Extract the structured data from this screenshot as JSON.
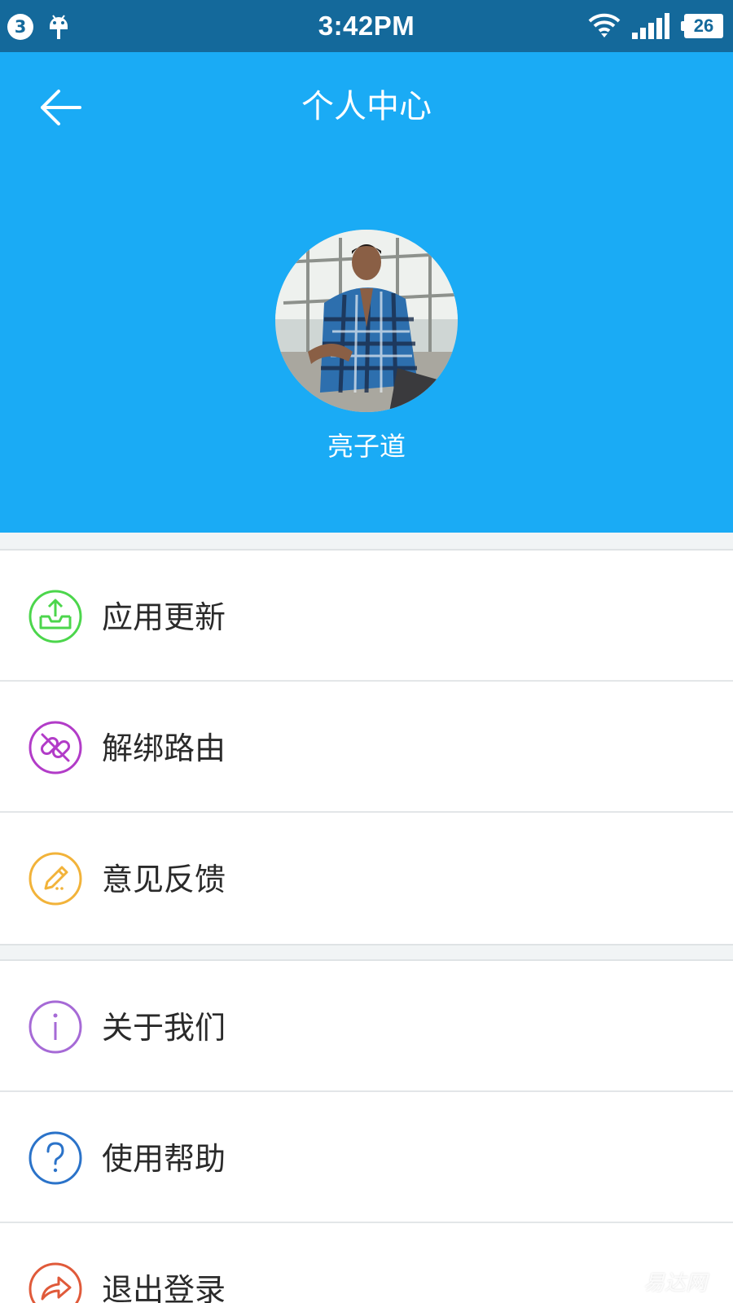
{
  "status_bar": {
    "notification_count": "3",
    "time": "3:42PM",
    "battery_level": "26"
  },
  "header": {
    "title": "个人中心",
    "username": "亮子道"
  },
  "menu": {
    "group1": [
      {
        "label": "应用更新",
        "icon": "app-update-icon",
        "color": "#4cd64c"
      },
      {
        "label": "解绑路由",
        "icon": "unbind-router-icon",
        "color": "#b23cc8"
      },
      {
        "label": "意见反馈",
        "icon": "feedback-icon",
        "color": "#f2b33a"
      }
    ],
    "group2": [
      {
        "label": "关于我们",
        "icon": "about-icon",
        "color": "#a66ad6"
      },
      {
        "label": "使用帮助",
        "icon": "help-icon",
        "color": "#2b73c9"
      },
      {
        "label": "退出登录",
        "icon": "logout-icon",
        "color": "#e05a3a"
      }
    ]
  },
  "colors": {
    "status_bar": "#14699b",
    "header": "#1aabf5",
    "background": "#f1f4f5"
  },
  "watermark": "易达网"
}
